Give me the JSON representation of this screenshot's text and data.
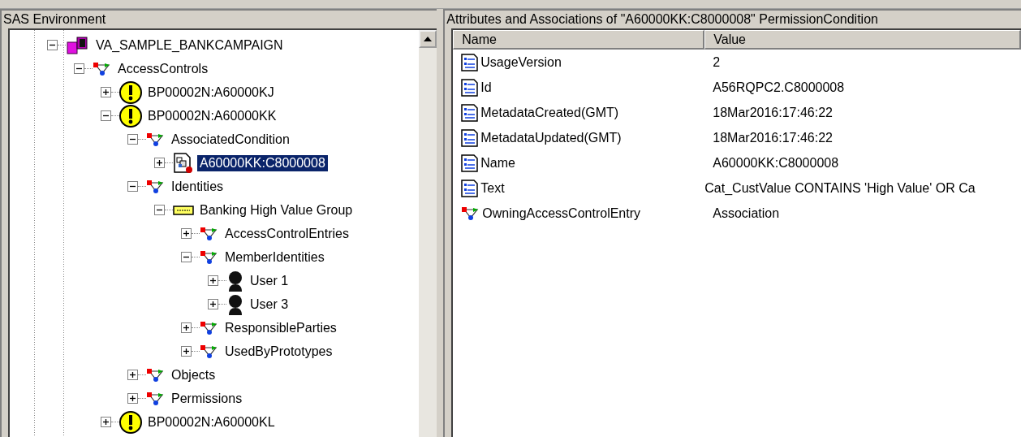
{
  "left_panel": {
    "title": "SAS Environment",
    "tree": [
      {
        "label": "VA_SAMPLE_BANKCAMPAIGN",
        "kind": "package",
        "expanded": true,
        "selected": false,
        "children": [
          {
            "label": "AccessControls",
            "kind": "association",
            "expanded": true,
            "selected": false,
            "children": [
              {
                "label": "BP00002N:A60000KJ",
                "kind": "warning",
                "expanded": false,
                "selected": false
              },
              {
                "label": "BP00002N:A60000KK",
                "kind": "warning",
                "expanded": true,
                "selected": false,
                "children": [
                  {
                    "label": "AssociatedCondition",
                    "kind": "association",
                    "expanded": true,
                    "selected": false,
                    "children": [
                      {
                        "label": "A60000KK:C8000008",
                        "kind": "condition",
                        "expanded": false,
                        "selected": true
                      }
                    ]
                  },
                  {
                    "label": "Identities",
                    "kind": "association",
                    "expanded": true,
                    "selected": false,
                    "children": [
                      {
                        "label": "Banking High Value Group",
                        "kind": "group",
                        "expanded": true,
                        "selected": false,
                        "children": [
                          {
                            "label": "AccessControlEntries",
                            "kind": "association",
                            "expanded": false,
                            "selected": false
                          },
                          {
                            "label": "MemberIdentities",
                            "kind": "association",
                            "expanded": true,
                            "selected": false,
                            "children": [
                              {
                                "label": "User 1",
                                "kind": "user",
                                "expanded": false,
                                "selected": false
                              },
                              {
                                "label": "User 3",
                                "kind": "user",
                                "expanded": false,
                                "selected": false
                              }
                            ]
                          },
                          {
                            "label": "ResponsibleParties",
                            "kind": "association",
                            "expanded": false,
                            "selected": false
                          },
                          {
                            "label": "UsedByPrototypes",
                            "kind": "association",
                            "expanded": false,
                            "selected": false
                          }
                        ]
                      }
                    ]
                  },
                  {
                    "label": "Objects",
                    "kind": "association",
                    "expanded": false,
                    "selected": false
                  },
                  {
                    "label": "Permissions",
                    "kind": "association",
                    "expanded": false,
                    "selected": false
                  }
                ]
              },
              {
                "label": "BP00002N:A60000KL",
                "kind": "warning",
                "expanded": false,
                "selected": false
              }
            ]
          }
        ]
      }
    ]
  },
  "right_panel": {
    "title": "Attributes and Associations of \"A60000KK:C8000008\" PermissionCondition",
    "columns": [
      "Name",
      "Value"
    ],
    "rows": [
      {
        "kind": "attribute",
        "name": "UsageVersion",
        "value": "2"
      },
      {
        "kind": "attribute",
        "name": "Id",
        "value": "A56RQPC2.C8000008"
      },
      {
        "kind": "attribute",
        "name": "MetadataCreated(GMT)",
        "value": "18Mar2016:17:46:22"
      },
      {
        "kind": "attribute",
        "name": "MetadataUpdated(GMT)",
        "value": "18Mar2016:17:46:22"
      },
      {
        "kind": "attribute",
        "name": "Name",
        "value": "A60000KK:C8000008"
      },
      {
        "kind": "attribute",
        "name": "Text",
        "value": "Cat_CustValue CONTAINS 'High Value' OR Ca"
      },
      {
        "kind": "association",
        "name": "OwningAccessControlEntry",
        "value": "Association"
      }
    ]
  }
}
